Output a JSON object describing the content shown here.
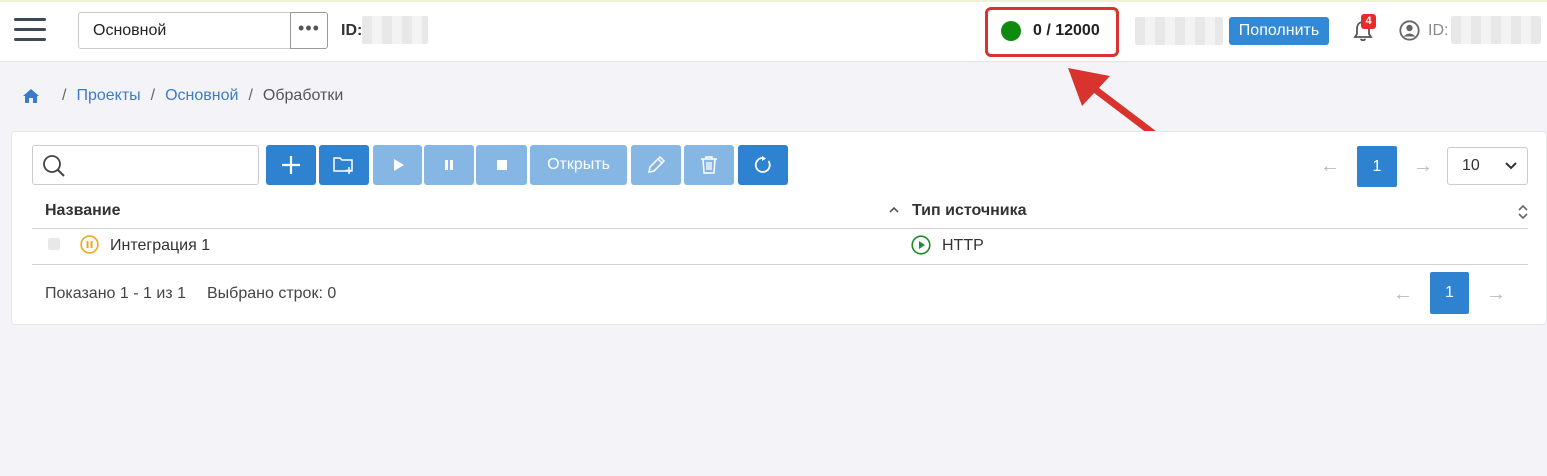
{
  "header": {
    "project": "Основной",
    "more_label": "•••",
    "id_label": "ID:",
    "balance": "0 / 12000",
    "balance_status_color": "#0f8a0f",
    "topup_label": "Пополнить",
    "notifications_count": "4",
    "user_id_label": "ID:"
  },
  "breadcrumb": {
    "items": [
      "Проекты",
      "Основной"
    ],
    "separator": "/",
    "current": "Обработки"
  },
  "toolbar": {
    "open_label": "Открыть",
    "accent_color": "#2f82d0"
  },
  "pagination": {
    "prev": "←",
    "page": "1",
    "next": "→",
    "page_size": "10"
  },
  "table": {
    "columns": [
      "Название",
      "Тип источника"
    ],
    "rows": [
      {
        "name": "Интеграция 1",
        "status_icon": "pause-icon",
        "source_icon": "play-icon",
        "source_type": "HTTP"
      }
    ]
  },
  "footer": {
    "shown": "Показано 1 - 1 из 1",
    "selected": "Выбрано строк: 0"
  },
  "annotation": {
    "box_color": "#d9332e"
  }
}
